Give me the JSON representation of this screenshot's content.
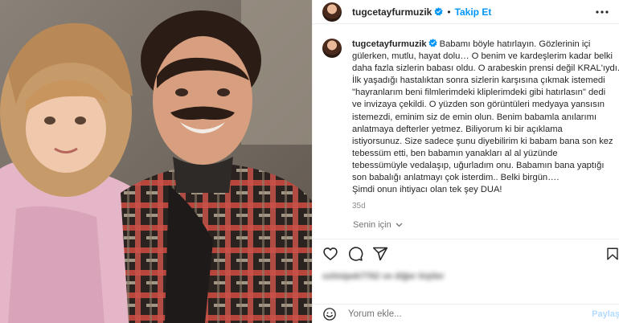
{
  "header": {
    "username": "tugcetayfurmuzik",
    "separator": "•",
    "follow_label": "Takip Et"
  },
  "caption": {
    "username": "tugcetayfurmuzik",
    "lines": [
      "Babamı böyle hatırlayın. Gözlerinin içi",
      "gülerken, mutlu, hayat dolu… O benim ve kardeşlerim kadar belki",
      "daha fazla sizlerin babası oldu. O arabeskin prensi değil KRAL'ıydı.",
      "İlk yaşadığı hastalıktan sonra sizlerin karşısına çıkmak istemedi",
      "\"hayranlarım beni filmlerimdeki kliplerimdeki gibi hatırlasın\" dedi",
      "ve invizaya çekildi. O yüzden son görüntüleri medyaya yansısın",
      "istemezdi, eminim siz de emin olun. Benim babamla anılarımı",
      "anlatmaya defterler yetmez. Biliyorum ki bir açıklama",
      "istiyorsunuz. Size sadece şunu diyebilirim ki babam bana son kez",
      "tebessüm etti, ben babamın yanakları al al yüzünde",
      "tebessümüyle vedalaşıp, uğurladım onu. Babamın bana yaptığı",
      "son babalığı anlatmayı çok isterdim.. Belki birgün….",
      "Şimdi onun ihtiyacı olan tek şey DUA!"
    ],
    "time": "35d"
  },
  "for_you_label": "Senin için",
  "likes_text": "ozlmipek7762 ve diğer kişiler",
  "comment": {
    "placeholder": "Yorum ekle...",
    "post_label": "Paylaş"
  },
  "colors": {
    "accent": "#0095f6",
    "text": "#262626",
    "muted": "#737373",
    "divider": "#efefef"
  },
  "icons": [
    "verified-badge-icon",
    "more-options-icon",
    "heart-icon",
    "comment-icon",
    "share-icon",
    "bookmark-icon",
    "emoji-icon",
    "chevron-down-icon"
  ]
}
